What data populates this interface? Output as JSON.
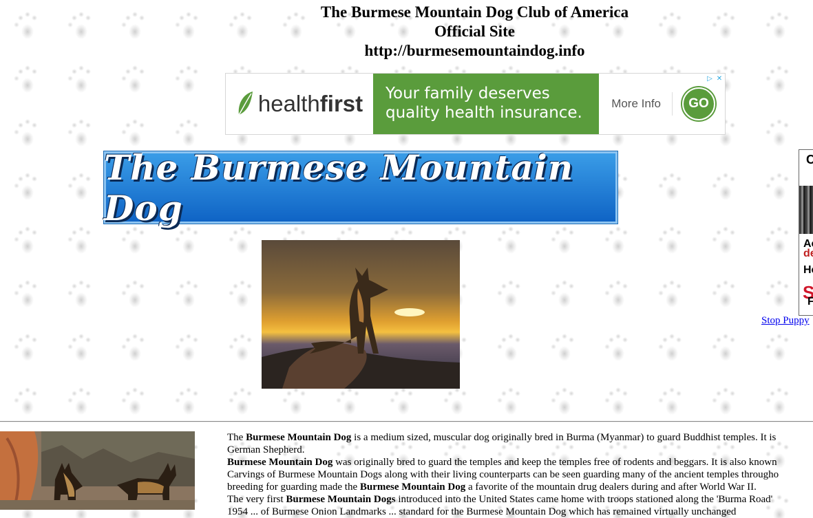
{
  "header": {
    "title": "The Burmese Mountain Dog Club of America",
    "subtitle": "Official Site",
    "url": "http://burmesemountaindog.info"
  },
  "ad_top": {
    "brand_prefix": "health",
    "brand_suffix": "first",
    "headline_line1": "Your family deserves",
    "headline_line2": "quality health insurance.",
    "more_info": "More Info",
    "go": "GO",
    "brand_color": "#5a9c3c"
  },
  "banner": {
    "text": "The Burmese Mountain Dog"
  },
  "side_ad": {
    "t1": "C",
    "t2": "Ac",
    "t3": "de",
    "t4": "He",
    "t5": "S",
    "t6": "F"
  },
  "stop_link": "Stop Puppy",
  "article": {
    "p1_a": "The ",
    "p1_b": "Burmese Mountain Dog",
    "p1_c": " is a medium sized, muscular dog originally bred in Burma (Myanmar) to guard Buddhist temples. It is",
    "p1_d": "German Shepherd.",
    "p2_b": "Burmese Mountain Dog",
    "p2_c": " was originally bred to guard the temples and keep the temples free of rodents and beggars. It is also known",
    "p2_d": "Carvings of Burmese Mountain Dogs along with their living counterparts can be seen guarding many of the ancient temples througho",
    "p2_e": "breeding for guarding made the ",
    "p2_f": "Burmese Mountain Dog",
    "p2_g": " a favorite of the mountain drug dealers during and after World War II.",
    "p3_a": "The very first ",
    "p3_b": "Burmese Mountain Dogs",
    "p3_c": " introduced into the United States came home with troops stationed along the 'Burma Road'",
    "p4": "1954 ... of Burmese Onion Landmarks ... standard for the Burmese Mountain Dog which has remained virtually unchanged"
  }
}
